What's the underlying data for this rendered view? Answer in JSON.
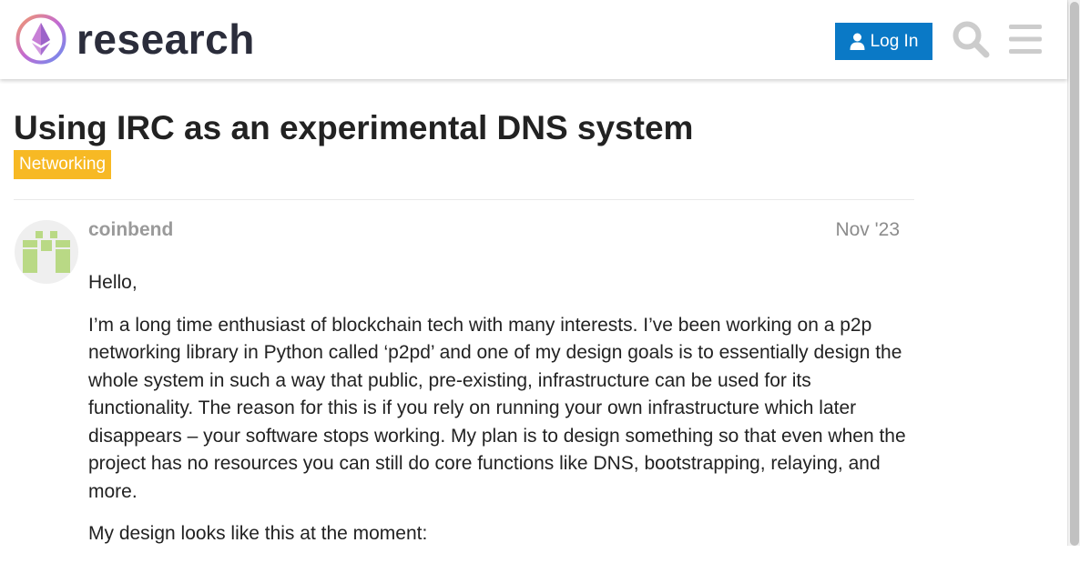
{
  "header": {
    "brand": "research",
    "login_label": "Log In",
    "icons": {
      "logo": "ethresear-logo-icon",
      "user": "user-icon",
      "search": "search-icon",
      "menu": "hamburger-menu-icon"
    },
    "colors": {
      "login_bg": "#0a79c6",
      "icon_gray": "#cccccc"
    }
  },
  "topic": {
    "title": "Using IRC as an experimental DNS system",
    "category": "Networking",
    "category_color": "#f7b924"
  },
  "post": {
    "author": "coinbend",
    "date": "Nov '23",
    "avatar_icon": "identicon-avatar-icon",
    "paragraphs": [
      "Hello,",
      "I’m a long time enthusiast of blockchain tech with many interests. I’ve been working on a p2p networking library in Python called ‘p2pd’ and one of my design goals is to essentially design the whole system in such a way that public, pre-existing, infrastructure can be used for its functionality. The reason for this is if you rely on running your own infrastructure which later disappears – your software stops working. My plan is to design something so that even when the project has no resources you can still do core functions like DNS, bootstrapping, relaying, and more.",
      "My design looks like this at the moment:"
    ]
  }
}
